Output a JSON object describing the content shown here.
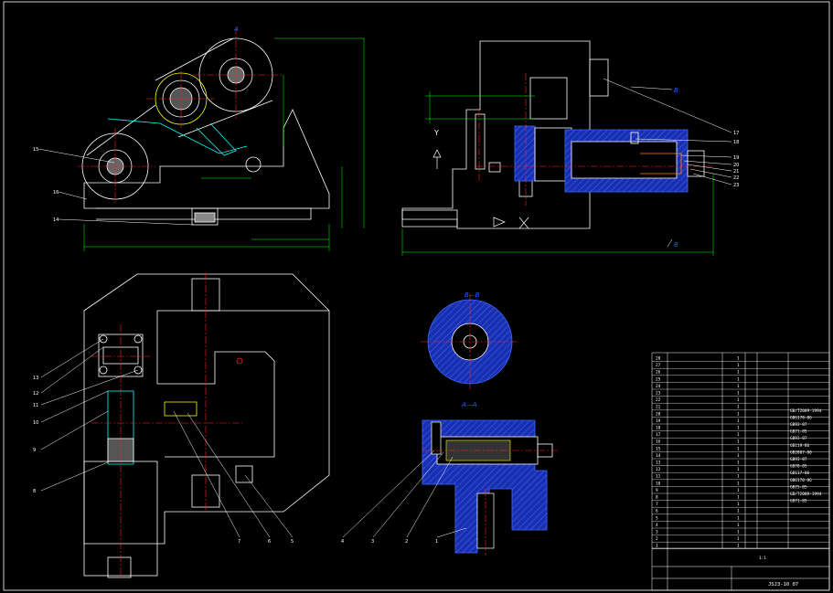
{
  "drawing": {
    "section_labels": {
      "a_top": "A",
      "a_a": "A—A",
      "b_b": "B—B",
      "b_top": "B",
      "b_bottom": "B"
    },
    "axis_labels": {
      "y": "Y",
      "x": "X"
    },
    "part_callouts_right": [
      "17",
      "18",
      "19",
      "20",
      "21",
      "22",
      "23"
    ],
    "part_callouts_left_top": [
      "15",
      "16",
      "14"
    ],
    "part_callouts_left_bottom": [
      "13",
      "12",
      "11",
      "10",
      "9",
      "8"
    ],
    "part_callouts_bottom": [
      "7",
      "6",
      "5",
      "4",
      "3",
      "2",
      "1"
    ]
  },
  "title_block": {
    "rows": [
      {
        "no": "28",
        "qty": "1"
      },
      {
        "no": "27",
        "qty": "1"
      },
      {
        "no": "26",
        "qty": "1"
      },
      {
        "no": "25",
        "qty": "1"
      },
      {
        "no": "24",
        "qty": "1"
      },
      {
        "no": "23",
        "qty": "1"
      },
      {
        "no": "22",
        "qty": "1"
      },
      {
        "no": "21",
        "qty": "1"
      },
      {
        "no": "20",
        "qty": "1"
      },
      {
        "no": "19",
        "qty": "1"
      },
      {
        "no": "18",
        "qty": "1"
      },
      {
        "no": "17",
        "qty": "1"
      },
      {
        "no": "16",
        "qty": "1"
      },
      {
        "no": "15",
        "qty": "1"
      },
      {
        "no": "14",
        "qty": "1"
      },
      {
        "no": "13",
        "qty": "1"
      },
      {
        "no": "12",
        "qty": "1"
      },
      {
        "no": "11",
        "qty": "1"
      },
      {
        "no": "10",
        "qty": "1"
      },
      {
        "no": "9",
        "qty": "1"
      },
      {
        "no": "8",
        "qty": "1"
      },
      {
        "no": "7",
        "qty": "1"
      },
      {
        "no": "6",
        "qty": "1"
      },
      {
        "no": "5",
        "qty": "1"
      },
      {
        "no": "4",
        "qty": "1"
      },
      {
        "no": "3",
        "qty": "1"
      },
      {
        "no": "2",
        "qty": "1"
      },
      {
        "no": "1",
        "qty": "1"
      }
    ],
    "std_codes": [
      "GB/T2089-1994",
      "GB6170-86",
      "GB93-87",
      "GB71-85",
      "GB93-87",
      "GB119-86",
      "GB2807-80",
      "GB93-87",
      "GB70-85",
      "GB117-86",
      "GB6170-86",
      "GB75-85",
      "GB/T2089-1994",
      "GB71-85"
    ],
    "scale": "1:1",
    "drawing_no": "JSJ3-10 07"
  },
  "colors": {
    "outline": "#ffffff",
    "centerline": "#ff2020",
    "dimension": "#00ff00",
    "hatch": "#1f4fff",
    "leader": "#ffffff",
    "cyan": "#00ffff",
    "yellow": "#ffff00"
  }
}
